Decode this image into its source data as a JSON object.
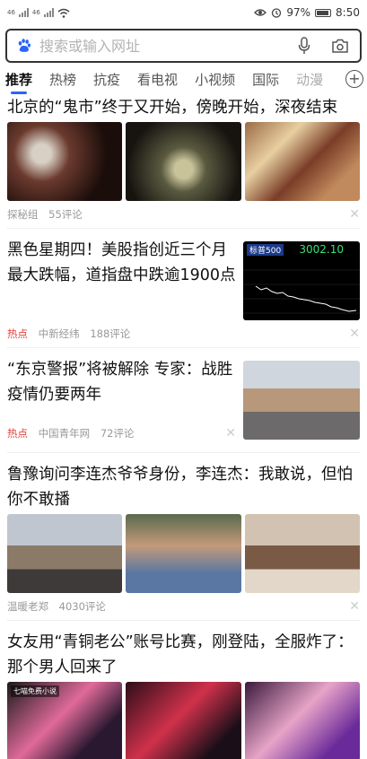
{
  "status": {
    "battery": "97%",
    "time": "8:50",
    "sim1": "46",
    "sim2": "46"
  },
  "search": {
    "placeholder": "搜索或输入网址"
  },
  "tabs": [
    {
      "label": "推荐"
    },
    {
      "label": "热榜"
    },
    {
      "label": "抗疫"
    },
    {
      "label": "看电视"
    },
    {
      "label": "小视频"
    },
    {
      "label": "国际"
    },
    {
      "label": "动漫"
    }
  ],
  "colors": {
    "accent": "#2a64f6",
    "hot": "#e0443d"
  },
  "feed": [
    {
      "title": "北京的“鬼市”终于又开始，傍晚开始，深夜结束",
      "source": "探秘组",
      "comments": "55评论"
    },
    {
      "title": "黑色星期四！美股指创近三个月最大跌幅，道指盘中跌逾1900点",
      "tag": "热点",
      "source": "中新经纬",
      "comments": "188评论",
      "stock": {
        "name": "标普500",
        "value": "3002.10"
      }
    },
    {
      "title": "“东京警报”将被解除 专家：战胜疫情仍要两年",
      "tag": "热点",
      "source": "中国青年网",
      "comments": "72评论"
    },
    {
      "title": "鲁豫询问李连杰爷爷身份，李连杰：我敢说，但怕你不敢播",
      "source": "温暖老郑",
      "comments": "4030评论"
    },
    {
      "title": "女友用“青铜老公”账号比赛，刚登陆，全服炸了：那个男人回来了",
      "overlay": "七喵免费小说"
    }
  ]
}
